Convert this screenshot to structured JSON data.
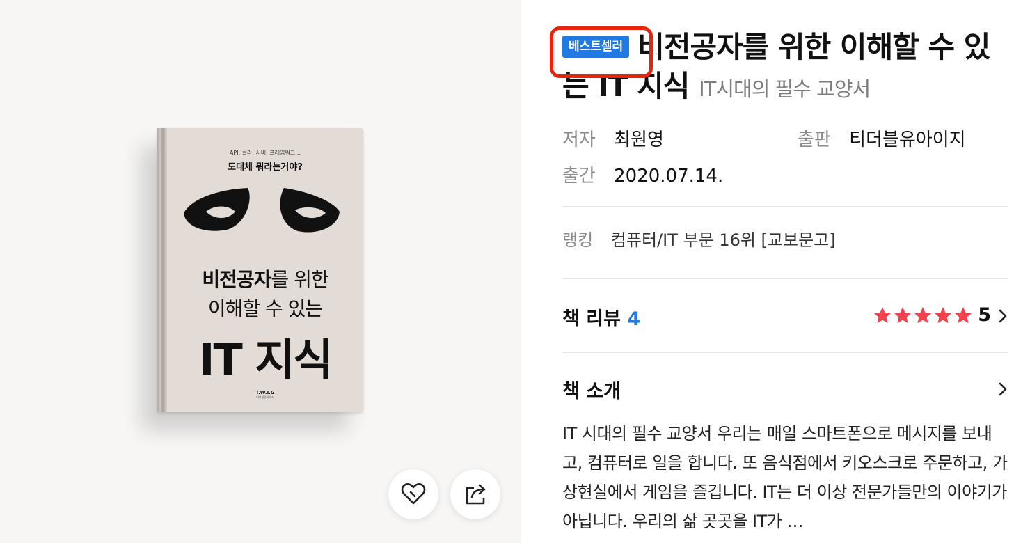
{
  "cover": {
    "subtitle_line": "API, 클라, 서버, 프레임워크…",
    "question": "도대체 뭐라는거야?",
    "title_line1_bold": "비전공자",
    "title_line1_rest": "를 위한",
    "title_line2": "이해할 수 있는",
    "title_line3": "IT 지식",
    "publisher_logo": "T.W.I.G",
    "publisher_small": "티더블유아이지"
  },
  "actions": {
    "like_icon": "heart-icon",
    "share_icon": "share-icon"
  },
  "product": {
    "badge": "베스트셀러",
    "title": "비전공자를 위한 이해할 수 있는 IT 지식",
    "subtitle": "IT시대의 필수 교양서",
    "author_label": "저자",
    "author": "최원영",
    "publisher_label": "출판",
    "publisher": "티더블유아이지",
    "date_label": "출간",
    "date": "2020.07.14.",
    "ranking_label": "랭킹",
    "ranking": "컴퓨터/IT 부문 16위 [교보문고]"
  },
  "review": {
    "label": "책 리뷰",
    "count": "4",
    "rating": "5",
    "stars": 5
  },
  "intro": {
    "label": "책 소개",
    "text": "IT 시대의 필수 교양서 우리는 매일 스마트폰으로 메시지를 보내고, 컴퓨터로 일을 합니다. 또 음식점에서 키오스크로 주문하고, 가상현실에서 게임을 즐깁니다. IT는 더 이상 전문가들만의 이야기가 아닙니다. 우리의 삶 곳곳을 IT가 …"
  },
  "colors": {
    "accent": "#2179e3",
    "highlight": "#e8250c",
    "star": "#f2424e"
  }
}
